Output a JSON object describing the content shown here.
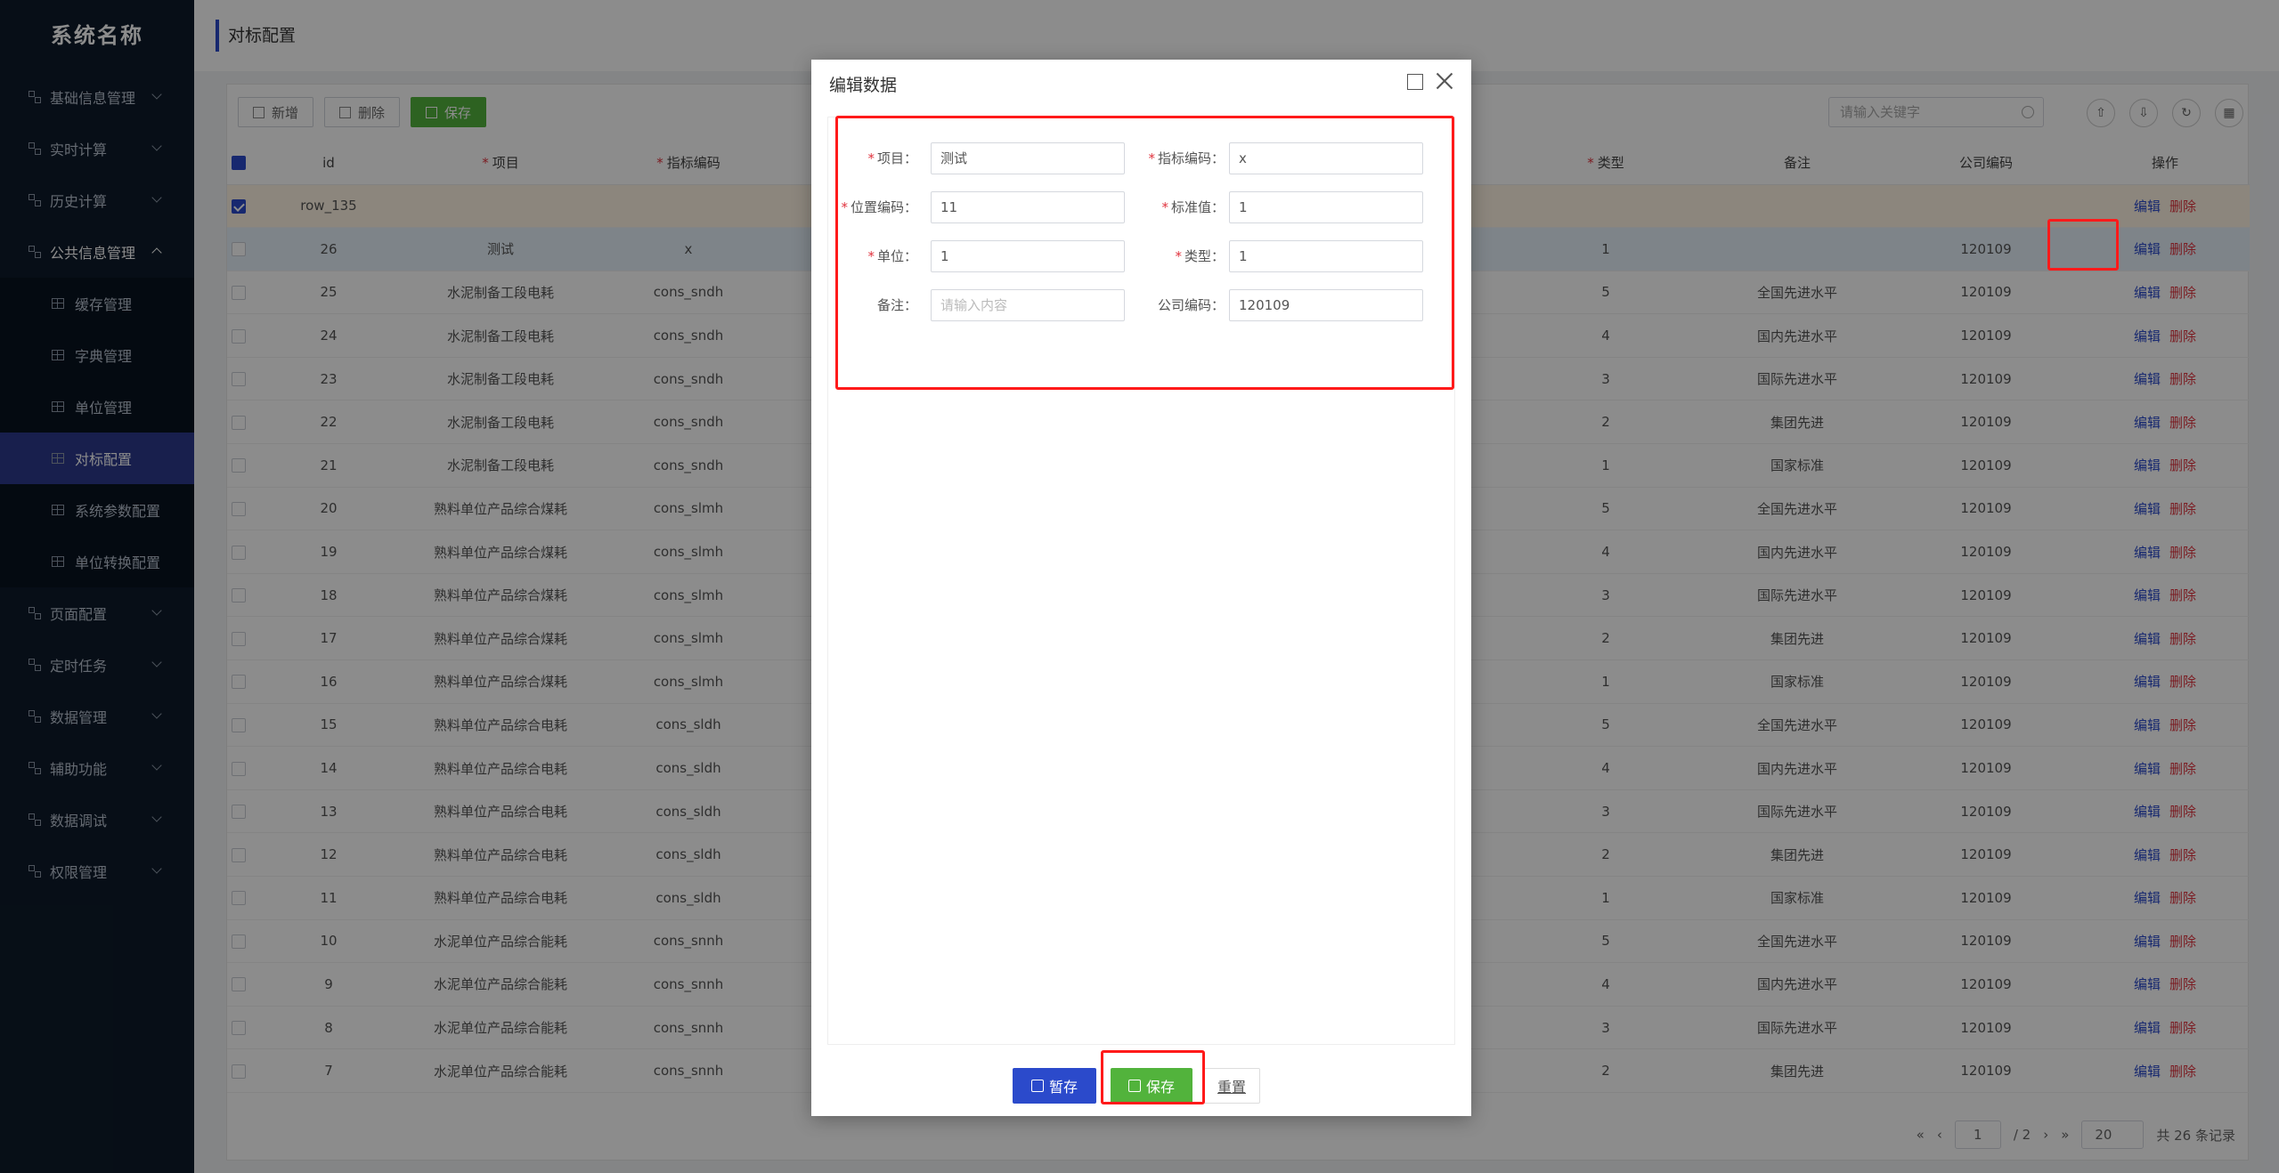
{
  "sidebar": {
    "logo": "系统名称",
    "menus": [
      {
        "label": "基础信息管理"
      },
      {
        "label": "实时计算"
      },
      {
        "label": "历史计算"
      },
      {
        "label": "公共信息管理"
      },
      {
        "label": "页面配置"
      },
      {
        "label": "定时任务"
      },
      {
        "label": "数据管理"
      },
      {
        "label": "辅助功能"
      },
      {
        "label": "数据调试"
      },
      {
        "label": "权限管理"
      }
    ],
    "sub_items": [
      {
        "label": "缓存管理"
      },
      {
        "label": "字典管理"
      },
      {
        "label": "单位管理"
      },
      {
        "label": "对标配置"
      },
      {
        "label": "系统参数配置"
      },
      {
        "label": "单位转换配置"
      }
    ]
  },
  "header": {
    "title": "对标配置"
  },
  "toolbar": {
    "add": "新增",
    "delete": "删除",
    "save": "保存"
  },
  "search": {
    "placeholder": "请输入关键字"
  },
  "table": {
    "headers": {
      "id": "id",
      "item": "项目",
      "code": "指标编码",
      "type": "类型",
      "remark": "备注",
      "company": "公司编码",
      "op": "操作"
    },
    "op_edit": "编辑",
    "op_delete": "删除",
    "rows": [
      {
        "id": "row_135",
        "item": "",
        "code": "",
        "type": "",
        "remark": "",
        "company": ""
      },
      {
        "id": "26",
        "item": "测试",
        "code": "x",
        "type": "1",
        "remark": "",
        "company": "120109"
      },
      {
        "id": "25",
        "item": "水泥制备工段电耗",
        "code": "cons_sndh",
        "type": "5",
        "remark": "全国先进水平",
        "company": "120109"
      },
      {
        "id": "24",
        "item": "水泥制备工段电耗",
        "code": "cons_sndh",
        "type": "4",
        "remark": "国内先进水平",
        "company": "120109"
      },
      {
        "id": "23",
        "item": "水泥制备工段电耗",
        "code": "cons_sndh",
        "type": "3",
        "remark": "国际先进水平",
        "company": "120109"
      },
      {
        "id": "22",
        "item": "水泥制备工段电耗",
        "code": "cons_sndh",
        "type": "2",
        "remark": "集团先进",
        "company": "120109"
      },
      {
        "id": "21",
        "item": "水泥制备工段电耗",
        "code": "cons_sndh",
        "type": "1",
        "remark": "国家标准",
        "company": "120109"
      },
      {
        "id": "20",
        "item": "熟料单位产品综合煤耗",
        "code": "cons_slmh",
        "type": "5",
        "remark": "全国先进水平",
        "company": "120109"
      },
      {
        "id": "19",
        "item": "熟料单位产品综合煤耗",
        "code": "cons_slmh",
        "type": "4",
        "remark": "国内先进水平",
        "company": "120109"
      },
      {
        "id": "18",
        "item": "熟料单位产品综合煤耗",
        "code": "cons_slmh",
        "type": "3",
        "remark": "国际先进水平",
        "company": "120109"
      },
      {
        "id": "17",
        "item": "熟料单位产品综合煤耗",
        "code": "cons_slmh",
        "type": "2",
        "remark": "集团先进",
        "company": "120109"
      },
      {
        "id": "16",
        "item": "熟料单位产品综合煤耗",
        "code": "cons_slmh",
        "type": "1",
        "remark": "国家标准",
        "company": "120109"
      },
      {
        "id": "15",
        "item": "熟料单位产品综合电耗",
        "code": "cons_sldh",
        "type": "5",
        "remark": "全国先进水平",
        "company": "120109"
      },
      {
        "id": "14",
        "item": "熟料单位产品综合电耗",
        "code": "cons_sldh",
        "type": "4",
        "remark": "国内先进水平",
        "company": "120109"
      },
      {
        "id": "13",
        "item": "熟料单位产品综合电耗",
        "code": "cons_sldh",
        "type": "3",
        "remark": "国际先进水平",
        "company": "120109"
      },
      {
        "id": "12",
        "item": "熟料单位产品综合电耗",
        "code": "cons_sldh",
        "type": "2",
        "remark": "集团先进",
        "company": "120109"
      },
      {
        "id": "11",
        "item": "熟料单位产品综合电耗",
        "code": "cons_sldh",
        "type": "1",
        "remark": "国家标准",
        "company": "120109"
      },
      {
        "id": "10",
        "item": "水泥单位产品综合能耗",
        "code": "cons_snnh",
        "type": "5",
        "remark": "全国先进水平",
        "company": "120109"
      },
      {
        "id": "9",
        "item": "水泥单位产品综合能耗",
        "code": "cons_snnh",
        "type": "4",
        "remark": "国内先进水平",
        "company": "120109"
      },
      {
        "id": "8",
        "item": "水泥单位产品综合能耗",
        "code": "cons_snnh",
        "type": "3",
        "remark": "国际先进水平",
        "company": "120109"
      },
      {
        "id": "7",
        "item": "水泥单位产品综合能耗",
        "code": "cons_snnh",
        "type": "2",
        "remark": "集团先进",
        "company": "120109"
      }
    ]
  },
  "pager": {
    "current": "1",
    "total_pages": "/ 2",
    "page_size": "20",
    "total": "共 26 条记录"
  },
  "modal": {
    "title": "编辑数据",
    "fields": {
      "item_label": "项目：",
      "item_value": "测试",
      "code_label": "指标编码：",
      "code_value": "x",
      "pos_label": "位置编码：",
      "pos_value": "11",
      "std_label": "标准值：",
      "std_value": "1",
      "unit_label": "单位：",
      "unit_value": "1",
      "type_label": "类型：",
      "type_value": "1",
      "remark_label": "备注：",
      "remark_placeholder": "请输入内容",
      "company_label": "公司编码：",
      "company_value": "120109"
    },
    "buttons": {
      "temp_save": "暂存",
      "save": "保存",
      "reset": "重置"
    }
  },
  "colors": {
    "primary": "#2b4acb",
    "success": "#52b33c",
    "danger": "#e0333e",
    "highlight": "#ff1a1a"
  }
}
